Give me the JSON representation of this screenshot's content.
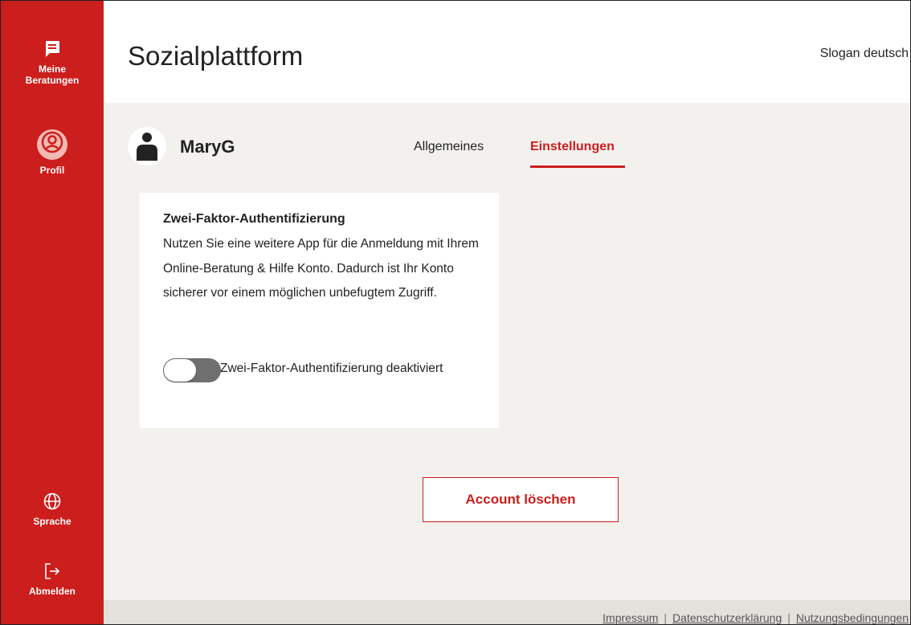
{
  "sidebar": {
    "items": [
      {
        "label_line1": "Meine",
        "label_line2": "Beratungen",
        "icon": "message-square-icon"
      },
      {
        "label": "Profil",
        "icon": "user-circle-icon",
        "active": true
      },
      {
        "label": "Sprache",
        "icon": "globe-icon"
      },
      {
        "label": "Abmelden",
        "icon": "logout-icon"
      }
    ]
  },
  "header": {
    "title": "Sozialplattform",
    "slogan": "Slogan deutsch"
  },
  "profile": {
    "username": "MaryG",
    "tabs": [
      {
        "label": "Allgemeines",
        "active": false
      },
      {
        "label": "Einstellungen",
        "active": true
      }
    ]
  },
  "two_factor": {
    "title": "Zwei-Faktor-Authentifizierung",
    "description": "Nutzen Sie eine weitere App für die Anmeldung mit Ihrem Online-Beratung & Hilfe Konto. Dadurch ist Ihr Konto sicherer vor einem möglichen unbefugtem Zugriff.",
    "toggle_label": "Zwei-Faktor-Authentifizierung deaktiviert",
    "enabled": false
  },
  "actions": {
    "delete_account": "Account löschen"
  },
  "footer": {
    "links": [
      "Impressum",
      "Datenschutzerklärung",
      "Nutzungsbedingungen"
    ],
    "separator": "|"
  },
  "colors": {
    "brand_red": "#cc1e1c",
    "background": "#f3f1ee",
    "toggle_off": "#6f6f6f"
  }
}
